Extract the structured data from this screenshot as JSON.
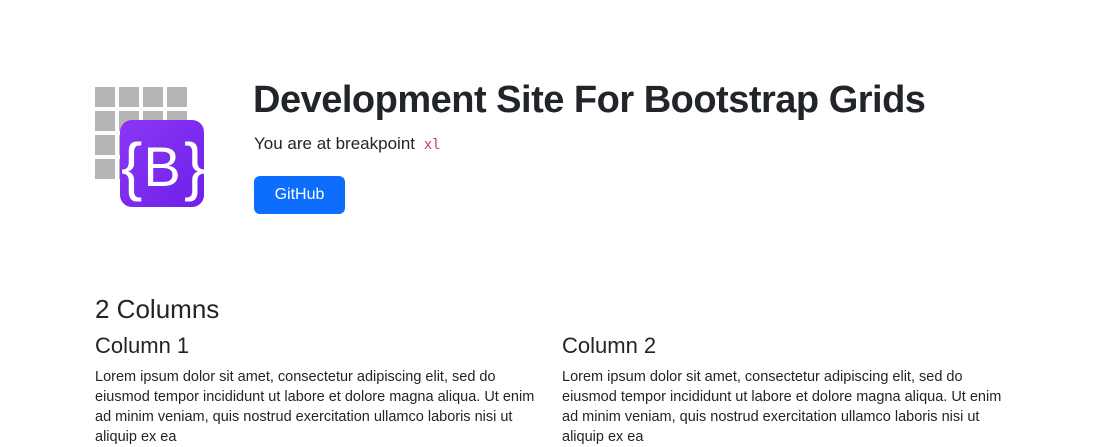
{
  "header": {
    "title": "Development Site For Bootstrap Grids",
    "breakpoint_prefix": "You are at breakpoint",
    "breakpoint_value": "xl",
    "github_button": "GitHub"
  },
  "logo": {
    "letter": "B",
    "brace_left": "{",
    "brace_right": "}"
  },
  "section": {
    "title": "2 Columns",
    "columns": [
      {
        "title": "Column 1",
        "text": "Lorem ipsum dolor sit amet, consectetur adipiscing elit, sed do eiusmod tempor incididunt ut labore et dolore magna aliqua. Ut enim ad minim veniam, quis nostrud exercitation ullamco laboris nisi ut aliquip ex ea"
      },
      {
        "title": "Column 2",
        "text": "Lorem ipsum dolor sit amet, consectetur adipiscing elit, sed do eiusmod tempor incididunt ut labore et dolore magna aliqua. Ut enim ad minim veniam, quis nostrud exercitation ullamco laboris nisi ut aliquip ex ea"
      }
    ]
  },
  "colors": {
    "primary": "#0d6efd",
    "bootstrap_purple": "#7a22f0",
    "grid_gray": "#b5b5b5",
    "code_pink": "#d63384"
  }
}
